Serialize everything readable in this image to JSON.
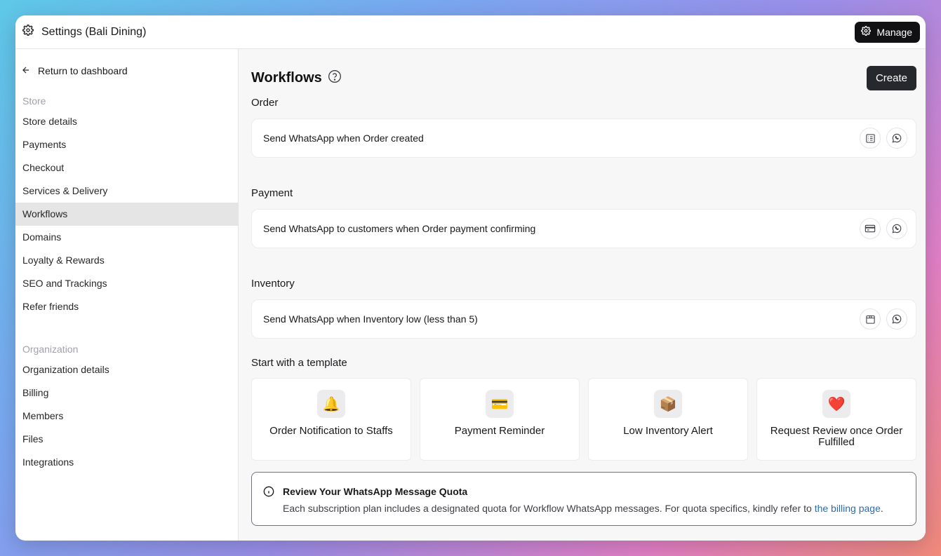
{
  "window": {
    "title": "Settings (Bali Dining)",
    "manage_label": "Manage"
  },
  "sidebar": {
    "back_label": "Return to dashboard",
    "store_section": "Store",
    "store_items": [
      "Store details",
      "Payments",
      "Checkout",
      "Services & Delivery",
      "Workflows",
      "Domains",
      "Loyalty & Rewards",
      "SEO and Trackings",
      "Refer friends"
    ],
    "active_item": "Workflows",
    "org_section": "Organization",
    "org_items": [
      "Organization details",
      "Billing",
      "Members",
      "Files",
      "Integrations"
    ]
  },
  "main": {
    "title": "Workflows",
    "create_label": "Create",
    "groups": [
      {
        "title": "Order",
        "workflow": "Send WhatsApp when Order created",
        "trigger_icon": "list-icon"
      },
      {
        "title": "Payment",
        "workflow": "Send WhatsApp to customers when Order payment confirming",
        "trigger_icon": "credit-card-icon"
      },
      {
        "title": "Inventory",
        "workflow": "Send WhatsApp when Inventory low (less than 5)",
        "trigger_icon": "box-icon"
      }
    ],
    "template_title": "Start with a template",
    "templates": [
      {
        "emoji": "🔔",
        "label": "Order Notification to Staffs"
      },
      {
        "emoji": "💳",
        "label": "Payment Reminder"
      },
      {
        "emoji": "📦",
        "label": "Low Inventory Alert"
      },
      {
        "emoji": "❤️",
        "label": "Request Review once Order Fulfilled"
      }
    ],
    "notice": {
      "title": "Review Your WhatsApp Message Quota",
      "body": "Each subscription plan includes a designated quota for Workflow WhatsApp messages. For quota specifics, kindly refer to ",
      "link": "the billing page",
      "end": "."
    }
  }
}
